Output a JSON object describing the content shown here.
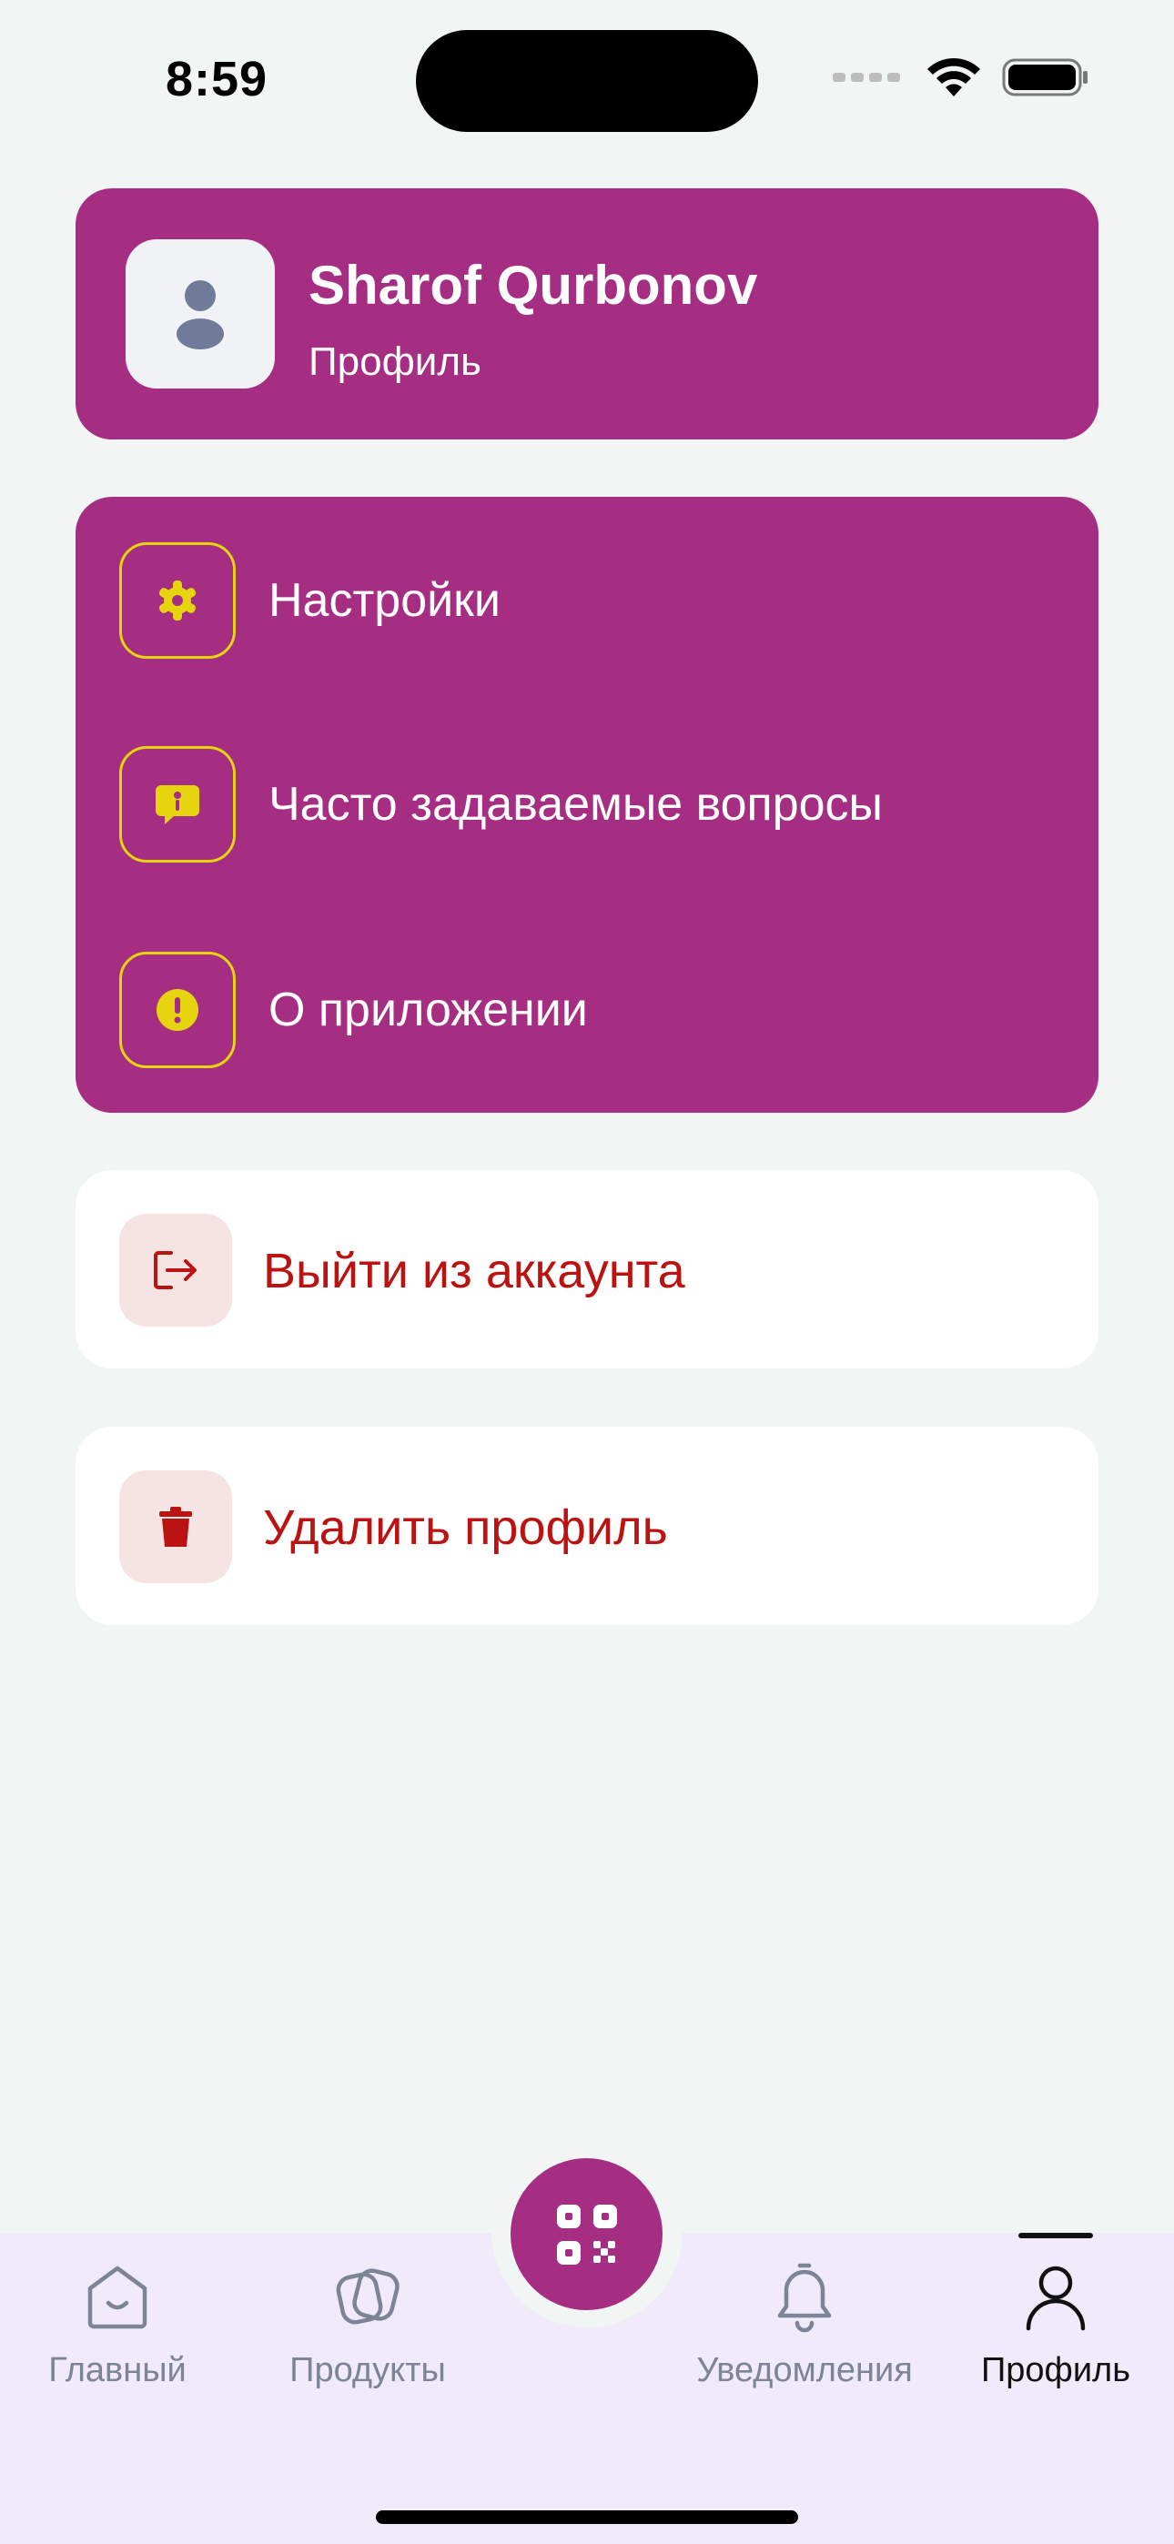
{
  "status_bar": {
    "time": "8:59"
  },
  "profile": {
    "name": "Sharof Qurbonov",
    "subtitle": "Профиль"
  },
  "menu": {
    "items": [
      {
        "label": "Настройки",
        "icon": "gear-icon"
      },
      {
        "label": "Часто задаваемые вопросы",
        "icon": "question-bubble-icon"
      },
      {
        "label": "О приложении",
        "icon": "info-icon"
      }
    ]
  },
  "actions": {
    "logout": {
      "label": "Выйти из аккаунта",
      "icon": "logout-icon"
    },
    "delete": {
      "label": "Удалить профиль",
      "icon": "trash-icon"
    }
  },
  "bottom_nav": {
    "items": [
      {
        "label": "Главный",
        "icon": "home-icon"
      },
      {
        "label": "Продукты",
        "icon": "products-icon"
      },
      {
        "label": "Уведомления",
        "icon": "bell-icon"
      },
      {
        "label": "Профиль",
        "icon": "profile-icon",
        "active": true
      }
    ],
    "center_action": {
      "icon": "qr-scan-icon"
    }
  },
  "colors": {
    "brand": "#a52d82",
    "accent": "#e6d40e",
    "danger": "#bb1212",
    "background": "#f1f5f4",
    "nav_background": "#f0eafb"
  }
}
